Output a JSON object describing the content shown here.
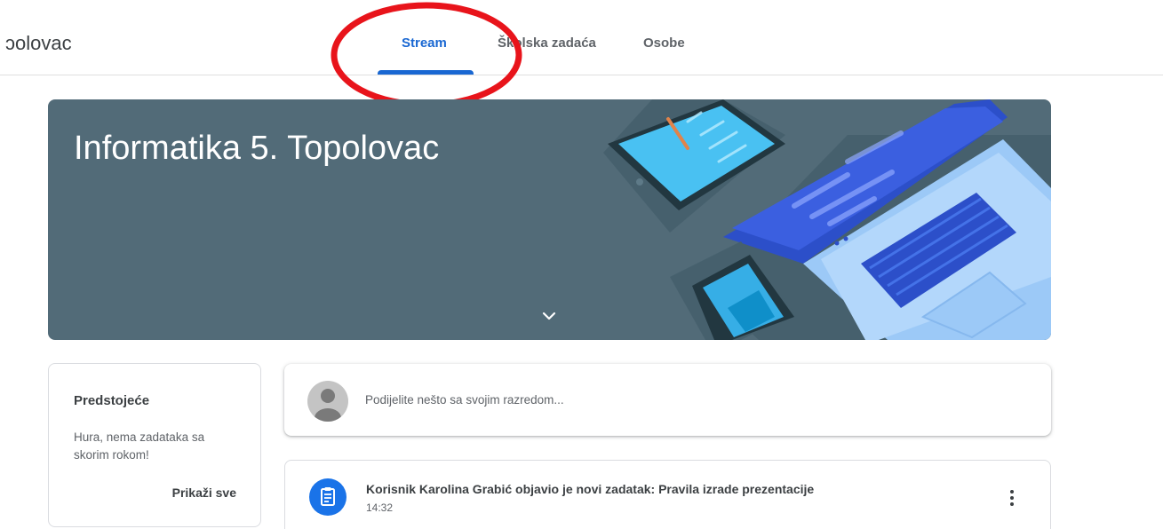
{
  "header": {
    "class_name": "ɔolovac",
    "tabs": [
      {
        "label": "Stream"
      },
      {
        "label": "Školska zadaća"
      },
      {
        "label": "Osobe"
      }
    ]
  },
  "banner": {
    "title": "Informatika 5. Topolovac",
    "expand_icon": "chevron-down-icon"
  },
  "upcoming": {
    "title": "Predstojeće",
    "message": "Hura, nema zadataka sa skorim rokom!",
    "view_all": "Prikaži sve"
  },
  "share": {
    "placeholder": "Podijelite nešto sa svojim razredom..."
  },
  "posts": [
    {
      "title": "Korisnik Karolina Grabić objavio je novi zadatak: Pravila izrade prezentacije",
      "time": "14:32",
      "icon": "assignment-icon"
    }
  ],
  "colors": {
    "accent": "#1967d2",
    "banner": "#526b78",
    "annotation": "#e8141b"
  }
}
